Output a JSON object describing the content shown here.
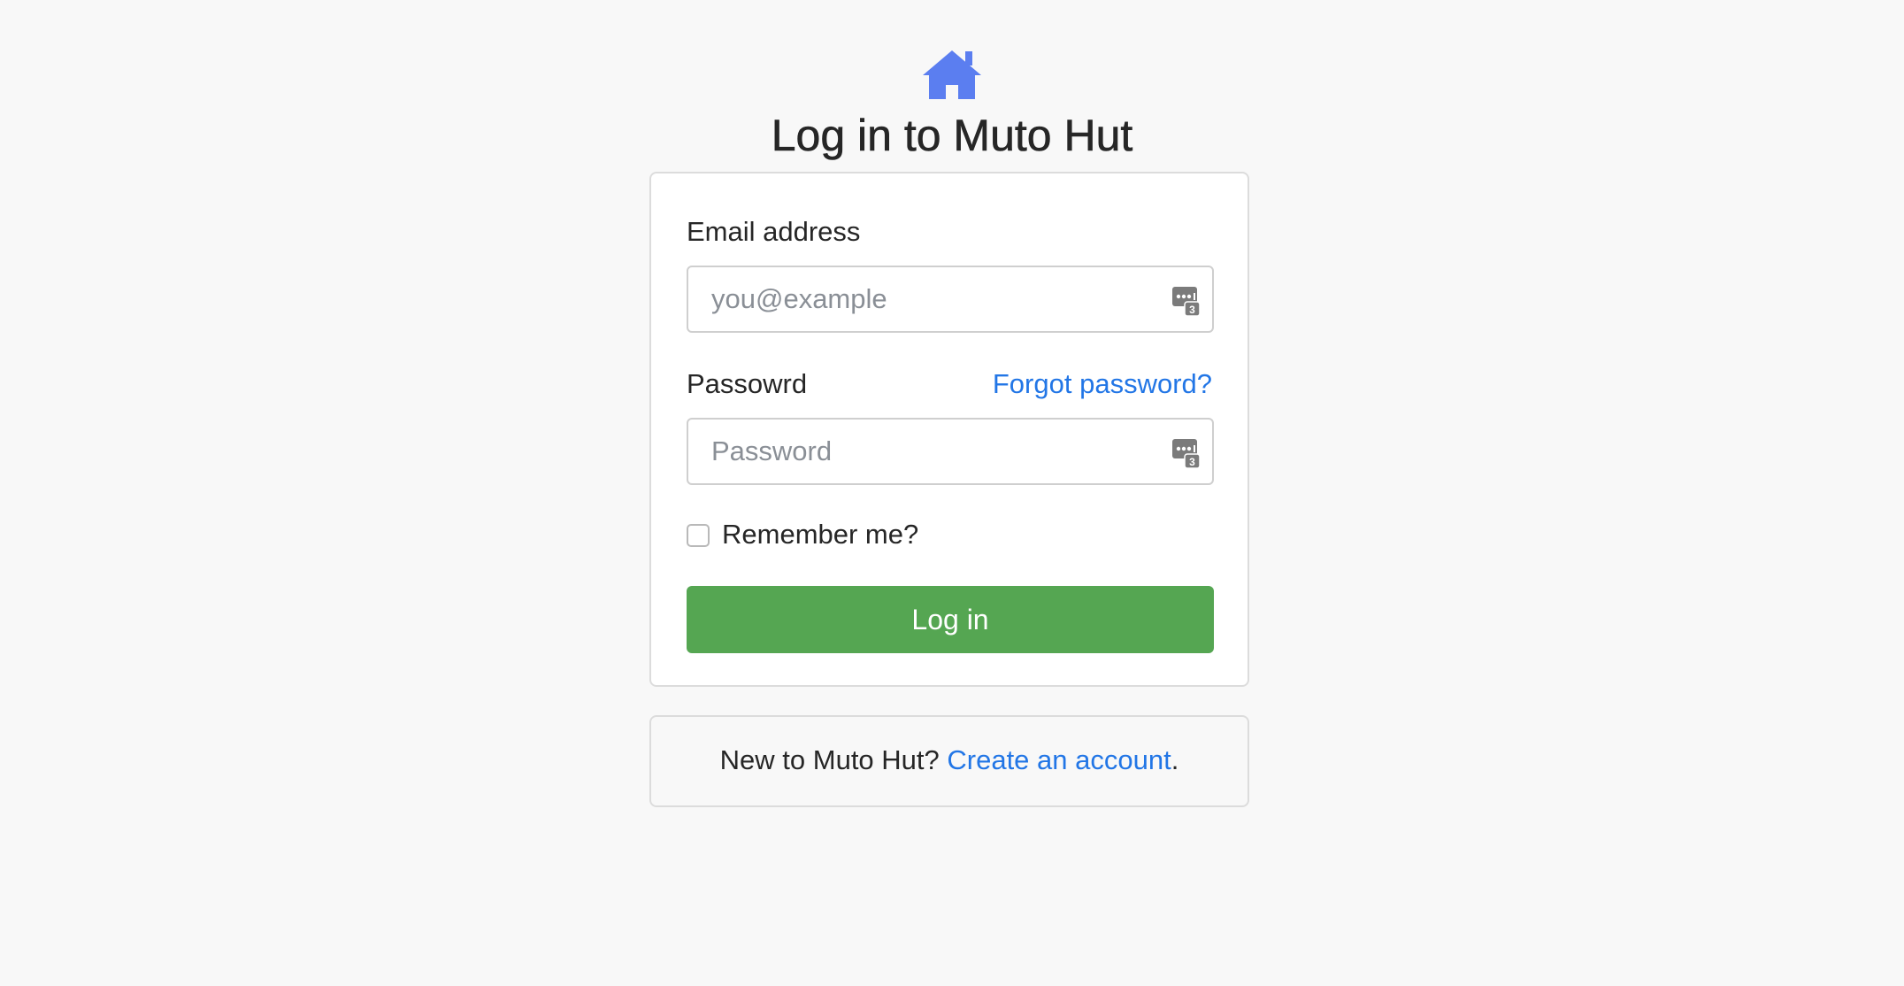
{
  "header": {
    "logo_icon": "house-icon",
    "logo_color": "#5b7ef0",
    "title": "Log in to Muto Hut"
  },
  "form": {
    "email": {
      "label": "Email address",
      "placeholder": "you@example",
      "value": "",
      "autofill_icon": "password-manager-icon",
      "autofill_badge": "3"
    },
    "password": {
      "label": "Passowrd",
      "forgot_link": "Forgot password?",
      "placeholder": "Password",
      "value": "",
      "autofill_icon": "password-manager-icon",
      "autofill_badge": "3"
    },
    "remember": {
      "label": "Remember me?",
      "checked": false
    },
    "submit_label": "Log in"
  },
  "signup": {
    "prompt": "New to Muto Hut? ",
    "link": "Create an account",
    "suffix": "."
  },
  "colors": {
    "accent_link": "#2276e6",
    "button": "#55a652",
    "background": "#f8f8f8"
  }
}
